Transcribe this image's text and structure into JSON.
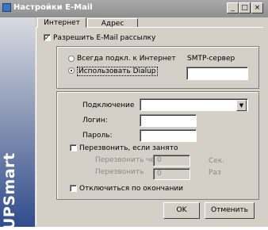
{
  "window": {
    "title": "Настройки E-Mail",
    "min": "_",
    "max": "□",
    "close": "×"
  },
  "tabs": [
    {
      "label": "Интернет"
    },
    {
      "label": "Адрес"
    }
  ],
  "brand": "UPSmart",
  "enable_mail": {
    "label": "Разрешить E-Mail рассылку",
    "checked": true
  },
  "connection": {
    "always_online": "Всегда подкл. к Интернет",
    "use_dialup": "Использовать Dialup",
    "smtp_label": "SMTP-сервер",
    "smtp_value": ""
  },
  "dialup": {
    "connection_label": "Подключение",
    "login_label": "Логин:",
    "password_label": "Пароль:",
    "redial_label": "Перезвонить, если занято",
    "redial_after_label": "Перезвонить через",
    "redial_after_value": "0",
    "redial_after_unit": "Сек.",
    "redial_times_label": "Перезвонить",
    "redial_times_value": "0",
    "redial_times_unit": "Раз",
    "disconnect_label": "Отключиться по окончании"
  },
  "buttons": {
    "ok": "OK",
    "cancel": "Отменить"
  }
}
